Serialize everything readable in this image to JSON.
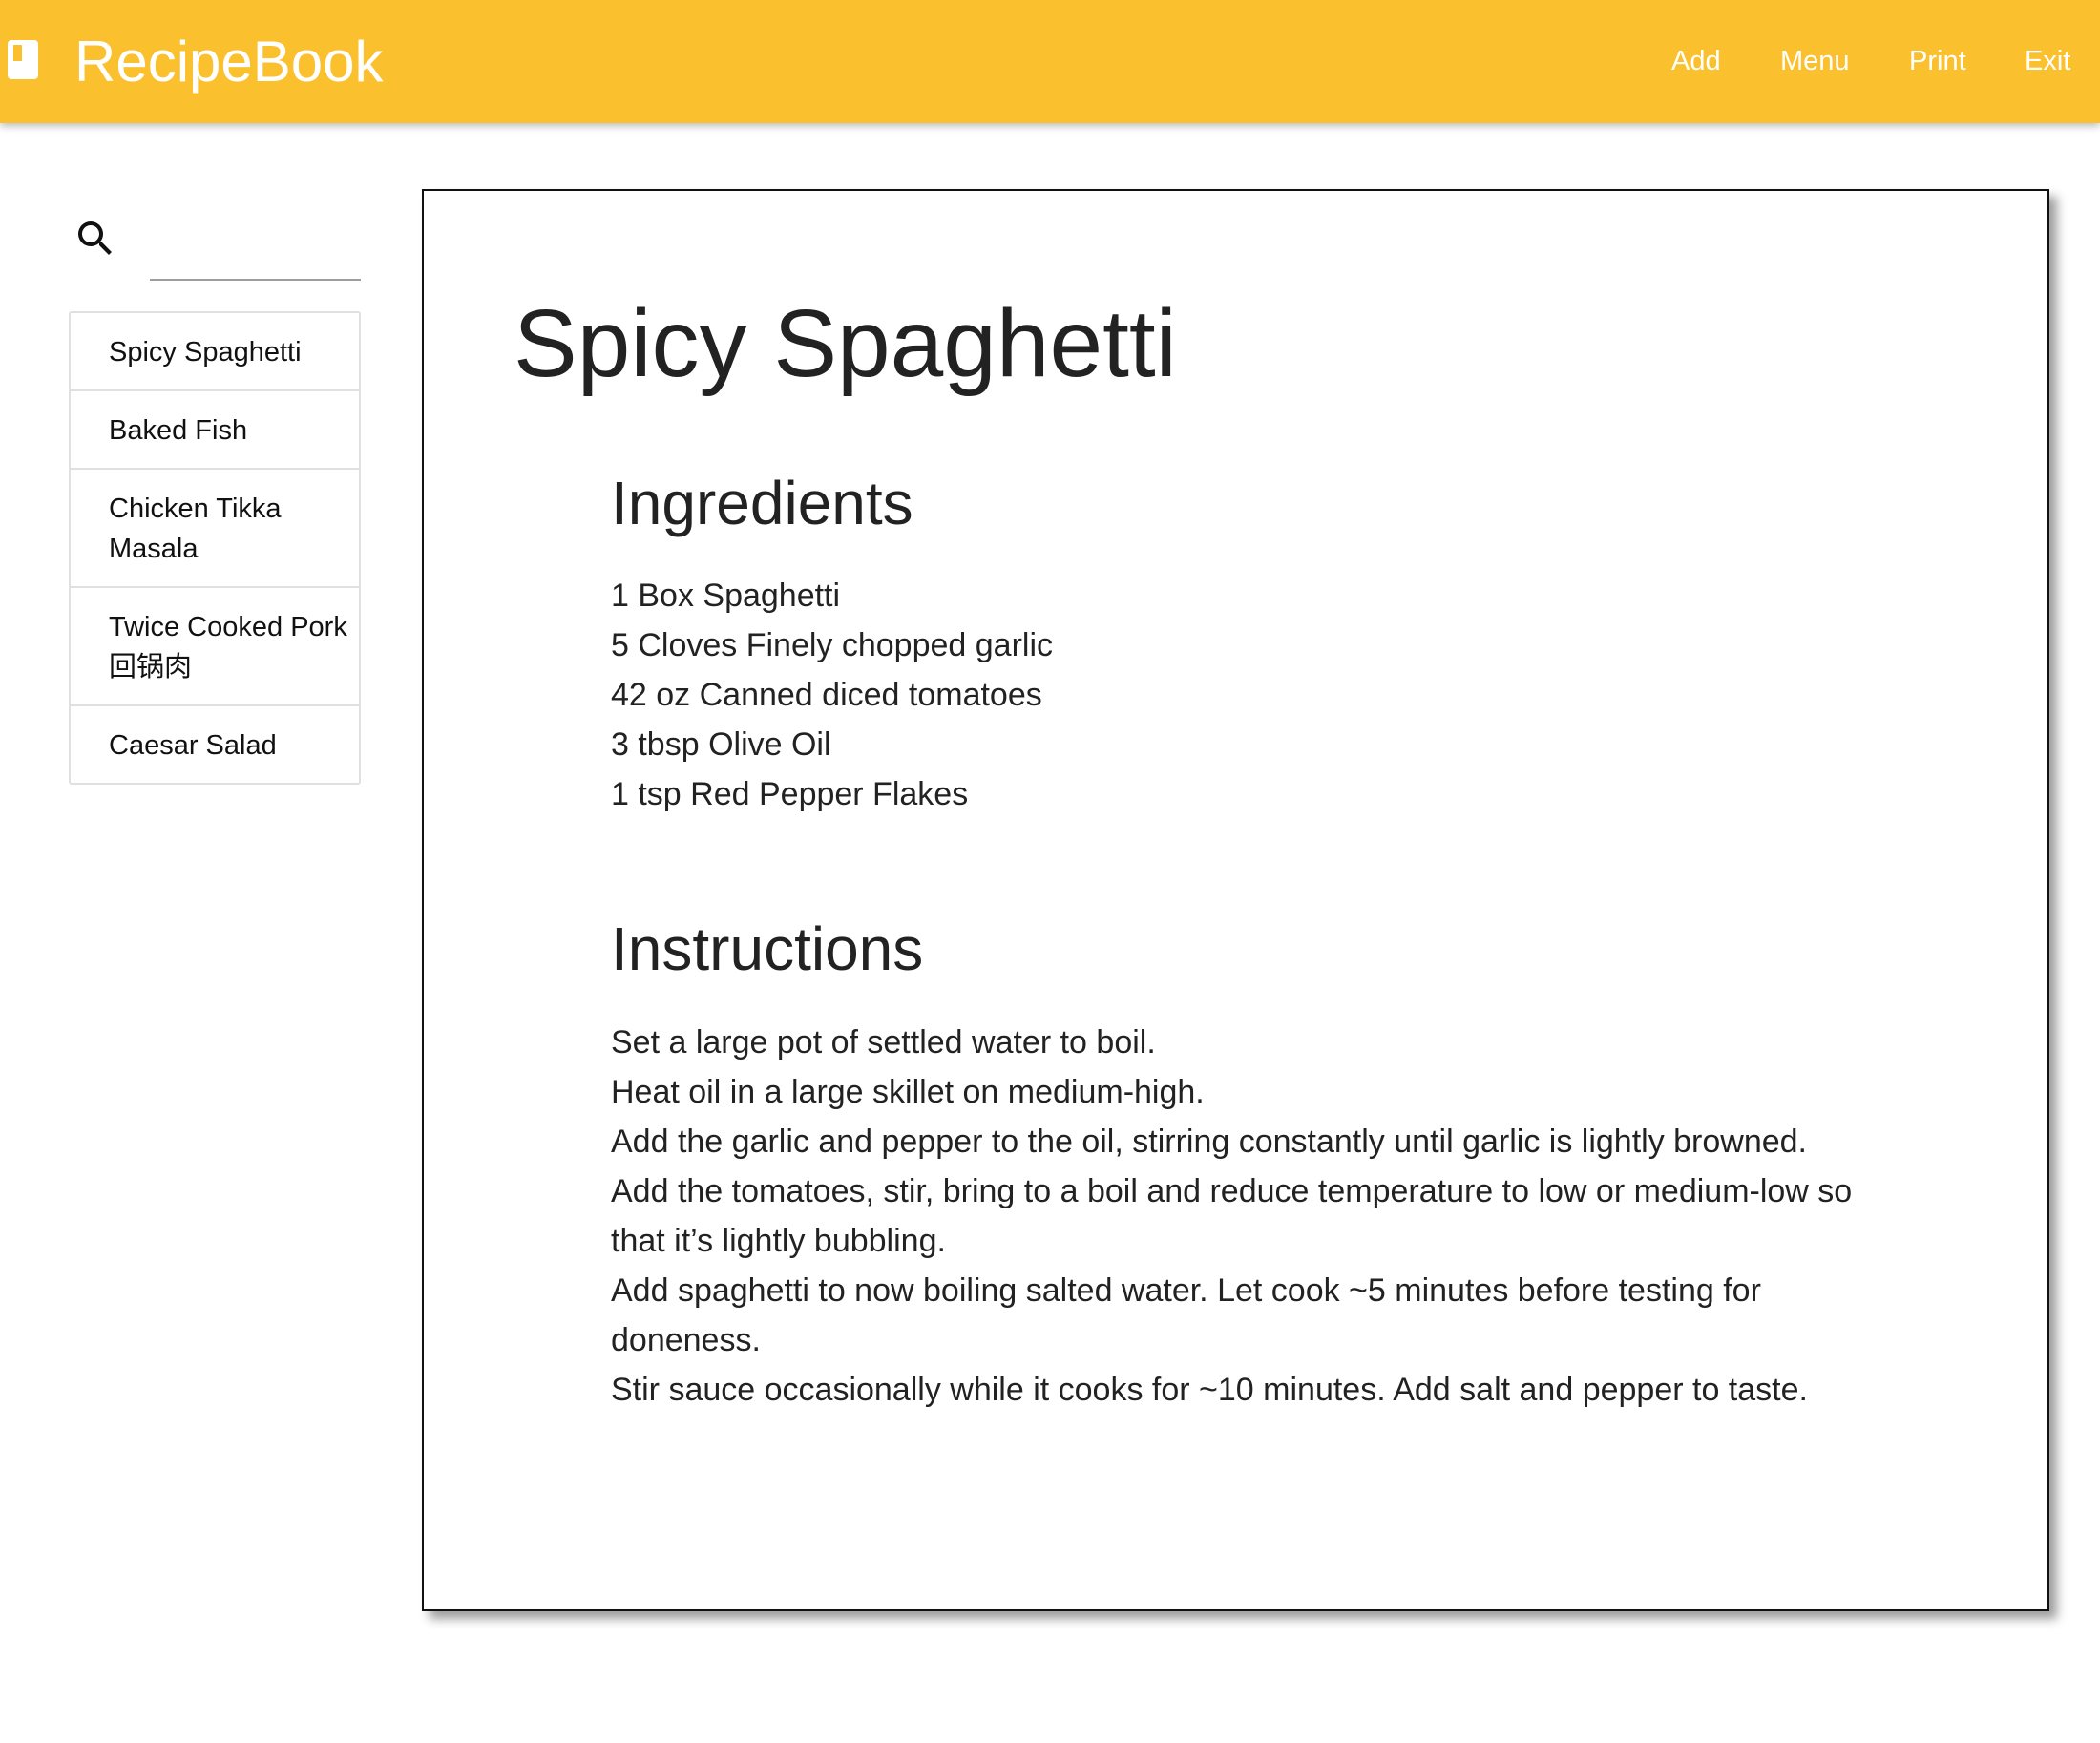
{
  "header": {
    "app_title": "RecipeBook",
    "brand_icon": "book-icon",
    "nav": [
      {
        "label": "Add"
      },
      {
        "label": "Menu"
      },
      {
        "label": "Print"
      },
      {
        "label": "Exit"
      }
    ]
  },
  "sidebar": {
    "search": {
      "icon": "search-icon",
      "value": "",
      "placeholder": ""
    },
    "recipes": [
      {
        "label": "Spicy Spaghetti"
      },
      {
        "label": "Baked Fish"
      },
      {
        "label": "Chicken Tikka Masala"
      },
      {
        "label": "Twice Cooked Pork 回锅肉"
      },
      {
        "label": "Caesar Salad"
      }
    ]
  },
  "recipe": {
    "title": "Spicy Spaghetti",
    "ingredients_heading": "Ingredients",
    "ingredients": [
      "1 Box Spaghetti",
      "5 Cloves Finely chopped garlic",
      "42 oz Canned diced tomatoes",
      "3 tbsp Olive Oil",
      "1 tsp Red Pepper Flakes"
    ],
    "instructions_heading": "Instructions",
    "instructions": [
      "Set a large pot of settled water to boil.",
      "Heat oil in a large skillet on medium-high.",
      "Add the garlic and pepper to the oil, stirring constantly until garlic is lightly browned.",
      "Add the tomatoes, stir, bring to a boil and reduce temperature to low or medium-low so that it’s lightly bubbling.",
      "Add spaghetti to now boiling salted water. Let cook ~5 minutes before testing for doneness.",
      "Stir sauce occasionally while it cooks for ~10 minutes. Add salt and pepper to taste."
    ]
  },
  "colors": {
    "app_bar": "#FBC02D",
    "app_bar_text": "#FFFFFF",
    "text": "#222222",
    "list_border": "#E0E0E0",
    "card_border": "#111111"
  }
}
